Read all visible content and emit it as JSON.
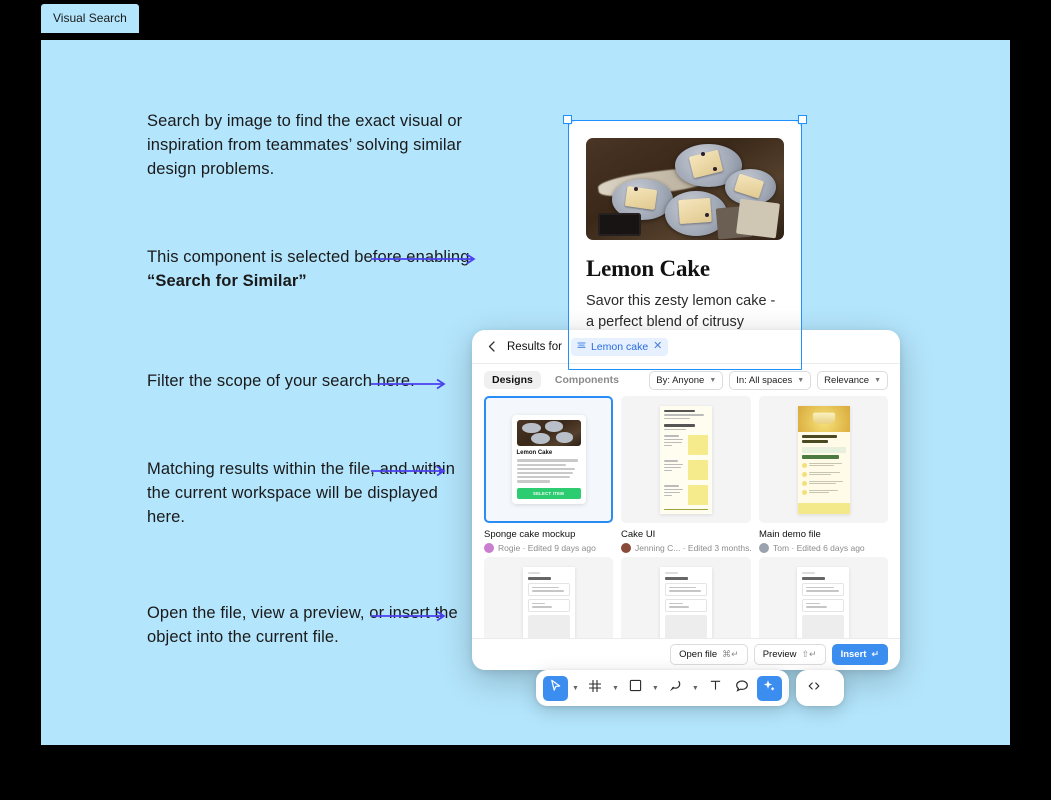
{
  "frame": {
    "tab_label": "Visual Search"
  },
  "annotations": [
    {
      "id": "a1",
      "text": "Search by image to find the exact visual or inspiration from teammates’ solving similar design problems."
    },
    {
      "id": "a2",
      "text_prefix": "This component is selected before enabling ",
      "text_bold": "“Search for Similar”"
    },
    {
      "id": "a3",
      "text": "Filter the scope of your search here."
    },
    {
      "id": "a4",
      "text": "Matching results within the file, and within the current workspace will be displayed here."
    },
    {
      "id": "a5",
      "text": "Open the file, view a preview, or insert the object into the current file."
    }
  ],
  "component_card": {
    "title": "Lemon Cake",
    "body": "Savor this zesty lemon cake - a perfect blend of citrusy goodness in a moist, fluffy treat.",
    "selection_color": "#1e90ff"
  },
  "panel": {
    "header": {
      "back_icon": "chevron-left-icon",
      "label": "Results for",
      "chip": {
        "icon": "layers-icon",
        "text": "Lemon cake",
        "close": "✕"
      }
    },
    "tabs": [
      {
        "label": "Designs",
        "active": true
      },
      {
        "label": "Components",
        "active": false
      }
    ],
    "filters": [
      {
        "label": "By: Anyone"
      },
      {
        "label": "In: All spaces"
      },
      {
        "label": "Relevance"
      }
    ],
    "results_row1": [
      {
        "name": "Sponge cake mockup",
        "meta": "Rogie · Edited 9 days ago",
        "author": "Rogie",
        "avatar_color": "#c97ed0",
        "selected": true,
        "mini": {
          "title": "Lemon Cake",
          "button": "SELECT ITEM",
          "button_color": "#2ecc71"
        }
      },
      {
        "name": "Cake UI",
        "meta": "Jenning C... · Edited 3 months...",
        "author": "Jenning C...",
        "avatar_color": "#8a4a3a",
        "selected": false
      },
      {
        "name": "Main demo file",
        "meta": "Tom · Edited 6 days ago",
        "author": "Tom",
        "avatar_color": "#9aa3ad",
        "selected": false
      }
    ],
    "footer": {
      "open_file": {
        "label": "Open file",
        "shortcut": "⌘↵"
      },
      "preview": {
        "label": "Preview",
        "shortcut": "⇧↵"
      },
      "insert": {
        "label": "Insert",
        "shortcut": "↵",
        "color": "#3b8ef0"
      }
    }
  },
  "toolbar": {
    "tools": [
      {
        "name": "move-tool",
        "icon": "cursor-icon",
        "active": true,
        "has_caret": true
      },
      {
        "name": "frame-tool",
        "icon": "hash-icon",
        "active": false,
        "has_caret": true
      },
      {
        "name": "shape-tool",
        "icon": "square-icon",
        "active": false,
        "has_caret": true
      },
      {
        "name": "pen-tool",
        "icon": "pen-icon",
        "active": false,
        "has_caret": true
      },
      {
        "name": "text-tool",
        "icon": "text-icon",
        "active": false,
        "has_caret": false
      },
      {
        "name": "comment-tool",
        "icon": "comment-icon",
        "active": false,
        "has_caret": false
      },
      {
        "name": "actions-tool",
        "icon": "sparkle-icon",
        "active": true,
        "has_caret": false
      }
    ],
    "dev_mode": {
      "name": "dev-mode-toggle",
      "icon": "code-icon"
    }
  },
  "colors": {
    "canvas_bg": "#b3e5fc",
    "page_bg": "#000000",
    "arrow": "#4b3ff0",
    "accent": "#3b8ef0"
  }
}
